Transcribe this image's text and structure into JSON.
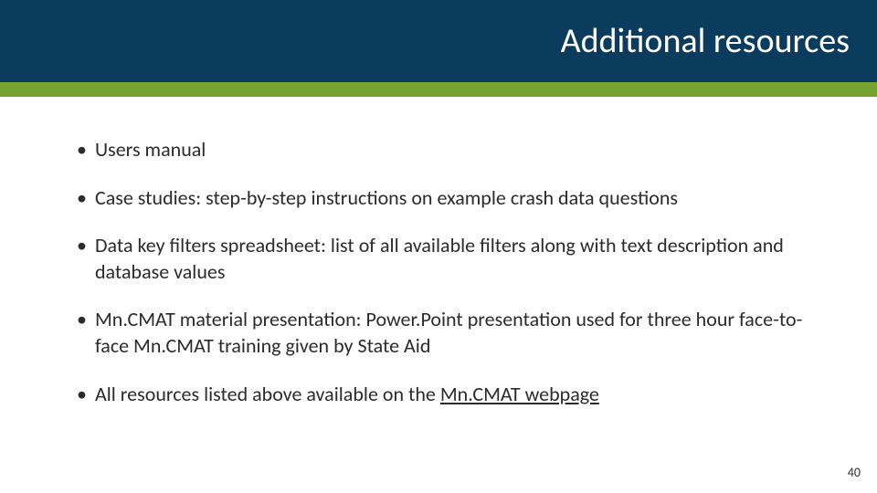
{
  "header": {
    "title": "Additional resources"
  },
  "colors": {
    "header_bg": "#0b3c5d",
    "accent_bg": "#78a22f"
  },
  "bullets": [
    {
      "text": "Users manual"
    },
    {
      "text": "Case studies: step-by-step instructions on example crash data questions"
    },
    {
      "text": "Data key filters spreadsheet: list of all available filters along with text description and database values"
    },
    {
      "text": "Mn.CMAT material presentation: Power.Point presentation used for three hour face-to-face Mn.CMAT training given by State Aid"
    },
    {
      "prefix": "All resources listed above available on the ",
      "link": "Mn.CMAT webpage"
    }
  ],
  "page_number": "40"
}
